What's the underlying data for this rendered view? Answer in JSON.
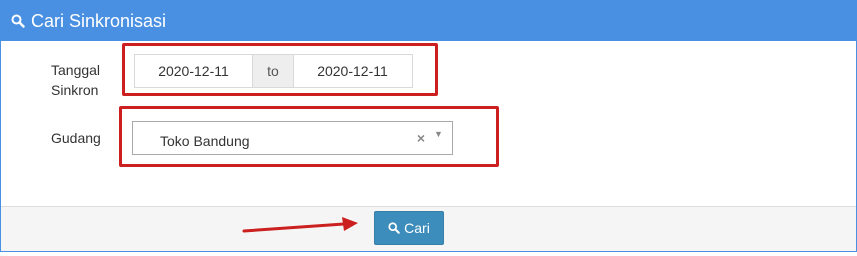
{
  "panel": {
    "title": "Cari Sinkronisasi",
    "title_icon": "search-icon"
  },
  "form": {
    "tanggal_label": "Tanggal\nSinkron",
    "date_from": "2020-12-11",
    "date_separator": "to",
    "date_to": "2020-12-11",
    "gudang_label": "Gudang",
    "gudang_value": "Toko Bandung",
    "clear_icon": "clear-icon",
    "dropdown_icon": "caret-down-icon"
  },
  "footer": {
    "search_button_label": "Cari",
    "search_button_icon": "search-icon"
  },
  "colors": {
    "header": "#4a90e2",
    "button": "#3c8dbc",
    "highlight": "#cc1f1f"
  }
}
